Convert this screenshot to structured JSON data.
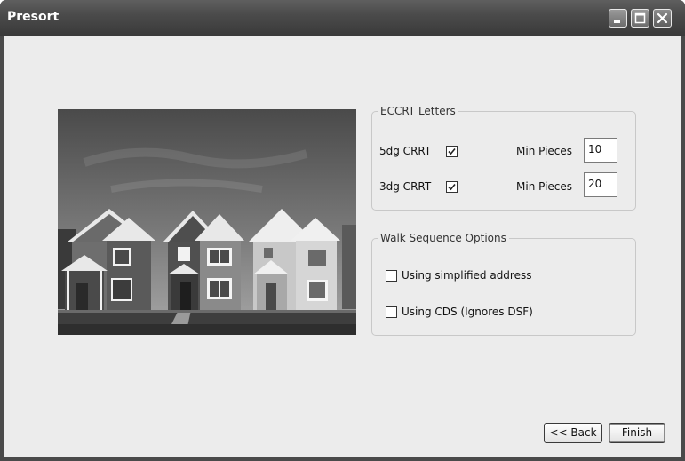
{
  "window": {
    "title": "Presort"
  },
  "illustration": "houses-photo",
  "eccrt_letters": {
    "legend": "ECCRT Letters",
    "rows": [
      {
        "label": "5dg CRRT",
        "checked": true,
        "min_label": "Min Pieces",
        "min_value": "10"
      },
      {
        "label": "3dg CRRT",
        "checked": true,
        "min_label": "Min Pieces",
        "min_value": "20"
      }
    ]
  },
  "walk_sequence": {
    "legend": "Walk Sequence Options",
    "simplified_address": {
      "label": "Using simplified address",
      "checked": false
    },
    "cds": {
      "label": "Using CDS (Ignores DSF)",
      "checked": false
    }
  },
  "buttons": {
    "back": "<< Back",
    "finish": "Finish"
  }
}
